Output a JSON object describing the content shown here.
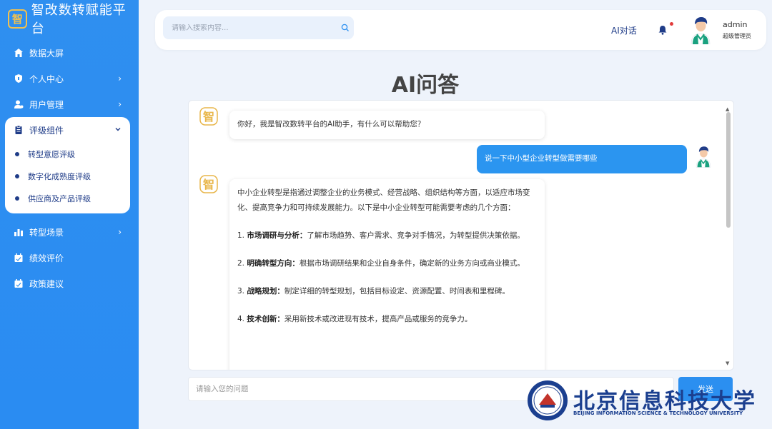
{
  "brand": {
    "logo_char": "智",
    "title": "智改数转赋能平台"
  },
  "sidebar": {
    "items": [
      {
        "label": "数据大屏",
        "icon": "home-icon"
      },
      {
        "label": "个人中心",
        "icon": "shield-icon",
        "has_chevron": true
      },
      {
        "label": "用户管理",
        "icon": "user-icon",
        "has_chevron": true
      }
    ],
    "group": {
      "label": "评级组件",
      "icon": "clipboard-icon",
      "expanded": true,
      "sub_items": [
        "转型意愿评级",
        "数字化成熟度评级",
        "供应商及产品评级"
      ]
    },
    "items_after": [
      {
        "label": "转型场景",
        "icon": "bar-chart-icon",
        "has_chevron": true
      },
      {
        "label": "绩效评价",
        "icon": "calendar-icon"
      },
      {
        "label": "政策建议",
        "icon": "calendar-icon"
      }
    ]
  },
  "header": {
    "search_placeholder": "请输入搜索内容...",
    "ai_chat_label": "AI对话",
    "user_name": "admin",
    "user_role": "超级管理员"
  },
  "page_title": "AI问答",
  "chat": {
    "greeting": "你好，我是智改数转平台的AI助手，有什么可以帮助您？",
    "user_question": "说一下中小型企业转型做需要哪些",
    "answer_intro": "中小企业转型是指通过调整企业的业务模式、经营战略、组织结构等方面，以适应市场变化、提高竞争力和可持续发展能力。以下是中小企业转型可能需要考虑的几个方面：",
    "points": [
      {
        "num": "1.",
        "title": "市场调研与分析",
        "text": "了解市场趋势、客户需求、竞争对手情况，为转型提供决策依据。"
      },
      {
        "num": "2.",
        "title": "明确转型方向",
        "text": "根据市场调研结果和企业自身条件，确定新的业务方向或商业模式。"
      },
      {
        "num": "3.",
        "title": "战略规划",
        "text": "制定详细的转型规划，包括目标设定、资源配置、时间表和里程碑。"
      },
      {
        "num": "4.",
        "title": "技术创新",
        "text": "采用新技术或改进现有技术，提高产品或服务的竞争力。"
      }
    ]
  },
  "ask": {
    "placeholder": "请输入您的问题",
    "send_label": "发送"
  },
  "watermark": {
    "cn": "北京信息科技大学",
    "en": "BEIJING INFORMATION SCIENCE & TECHNOLOGY UNIVERSITY"
  },
  "colors": {
    "sidebar": "#2f8ff0",
    "accent": "#2b95f0",
    "brand_gold": "#f2c14e",
    "navy": "#1f3c88"
  }
}
